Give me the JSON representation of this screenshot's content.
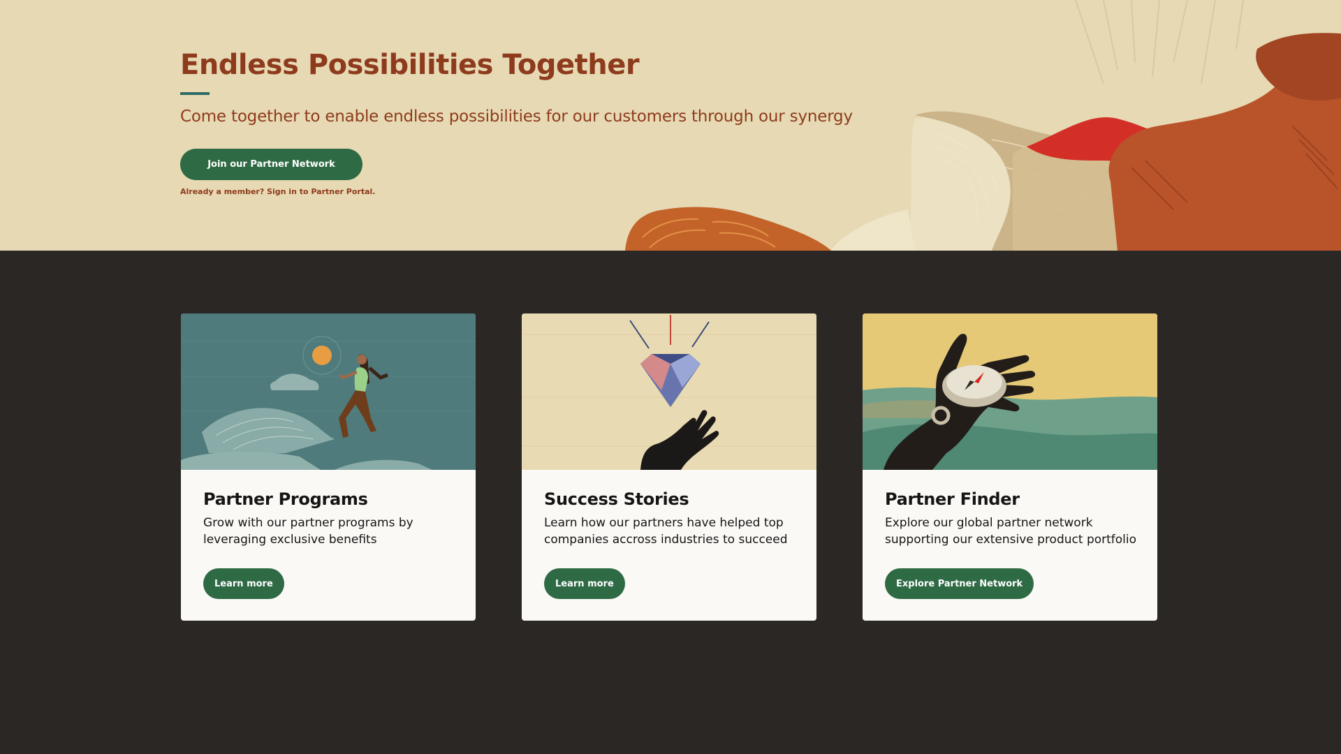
{
  "hero": {
    "title": "Endless Possibilities Together",
    "subtitle": "Come together to enable endless possibilities for our customers through our synergy",
    "join_button": "Join our Partner Network",
    "member_link": "Already a member? Sign in to Partner Portal."
  },
  "cards": [
    {
      "title": "Partner Programs",
      "description": "Grow with our partner programs by leveraging exclusive benefits",
      "button": "Learn more",
      "image_icon": "woman-running-illustration"
    },
    {
      "title": "Success Stories",
      "description": "Learn how our partners have helped top companies accross industries to succeed",
      "button": "Learn more",
      "image_icon": "diamond-hand-illustration"
    },
    {
      "title": "Partner Finder",
      "description": "Explore our global partner network supporting our extensive product portfolio",
      "button": "Explore Partner Network",
      "image_icon": "compass-hand-illustration"
    }
  ],
  "colors": {
    "accent_green": "#2e6a44",
    "brand_rust": "#8e3b1d",
    "hero_bg": "#e6d9b4",
    "page_bg": "#2b2725",
    "card_bg": "#fbf9f6"
  }
}
